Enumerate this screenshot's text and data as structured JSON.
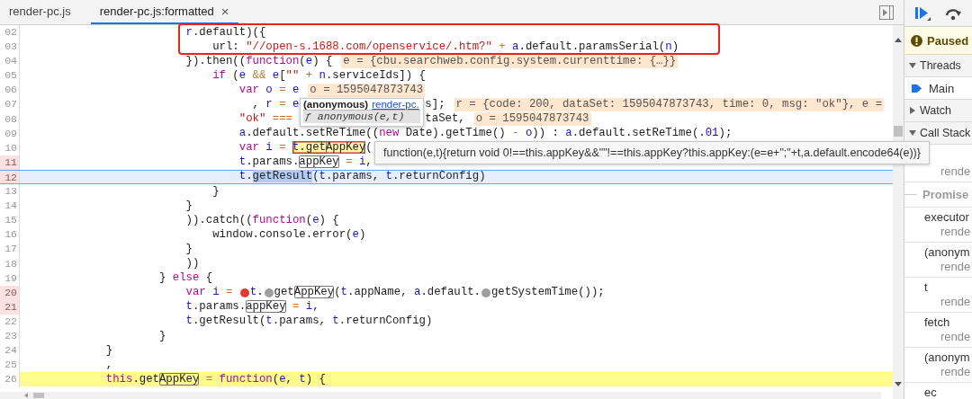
{
  "tabs": [
    {
      "label": "render-pc.js",
      "selected": false
    },
    {
      "label": "render-pc.js:formatted",
      "selected": true,
      "close": "×"
    }
  ],
  "lines": [
    {
      "number": "02",
      "breakpoint": false,
      "selected": false,
      "paused": false,
      "segments": [
        {
          "kind": "name",
          "text": "                        r"
        },
        {
          "kind": "plain",
          "text": ".default)({"
        }
      ]
    },
    {
      "number": "03",
      "breakpoint": false,
      "selected": false,
      "paused": false,
      "segments": [
        {
          "kind": "plain",
          "text": "                            url: "
        },
        {
          "kind": "str",
          "text": "\"//open-s.1688.com/openservice/.htm?\""
        },
        {
          "kind": "op",
          "text": " + "
        },
        {
          "kind": "name",
          "text": "a"
        },
        {
          "kind": "plain",
          "text": ".default.paramsSerial("
        },
        {
          "kind": "name",
          "text": "n"
        },
        {
          "kind": "plain",
          "text": ")"
        }
      ]
    },
    {
      "number": "04",
      "breakpoint": false,
      "selected": false,
      "paused": false,
      "segments": [
        {
          "kind": "plain",
          "text": "                        }).then(("
        },
        {
          "kind": "kw",
          "text": "function"
        },
        {
          "kind": "plain",
          "text": "("
        },
        {
          "kind": "name",
          "text": "e"
        },
        {
          "kind": "plain",
          "text": ") {"
        },
        {
          "kind": "inline",
          "text": "e = {cbu.searchweb.config.system.currenttime: {…}}"
        }
      ]
    },
    {
      "number": "05",
      "breakpoint": false,
      "selected": false,
      "paused": false,
      "segments": [
        {
          "kind": "kw",
          "text": "                            if"
        },
        {
          "kind": "plain",
          "text": " ("
        },
        {
          "kind": "name",
          "text": "e"
        },
        {
          "kind": "op",
          "text": " && "
        },
        {
          "kind": "name",
          "text": "e"
        },
        {
          "kind": "plain",
          "text": "["
        },
        {
          "kind": "str",
          "text": "\"\""
        },
        {
          "kind": "op",
          "text": " + "
        },
        {
          "kind": "name",
          "text": "n"
        },
        {
          "kind": "plain",
          "text": ".serviceIds]) {"
        }
      ]
    },
    {
      "number": "06",
      "breakpoint": false,
      "selected": false,
      "paused": false,
      "segments": [
        {
          "kind": "kw",
          "text": "                                var "
        },
        {
          "kind": "name",
          "text": "o"
        },
        {
          "kind": "op",
          "text": " = "
        },
        {
          "kind": "name",
          "text": "e"
        },
        {
          "kind": "inline",
          "text": "o = 1595047873743"
        }
      ]
    },
    {
      "number": "07",
      "breakpoint": false,
      "selected": false,
      "paused": false,
      "segments": [
        {
          "kind": "plain",
          "text": "                                  , "
        },
        {
          "kind": "name",
          "text": "r"
        },
        {
          "kind": "op",
          "text": " = "
        },
        {
          "kind": "name",
          "text": "e"
        }
      ],
      "after_popup": [
        {
          "kind": "plain",
          "text": "s];"
        },
        {
          "kind": "inline",
          "text": "r = {code: 200, dataSet: 1595047873743, time: 0, msg: \"ok\"}, e ="
        }
      ]
    },
    {
      "number": "08",
      "breakpoint": false,
      "selected": false,
      "paused": false,
      "segments": [
        {
          "kind": "str",
          "text": "                                \"ok\""
        },
        {
          "kind": "op",
          "text": " === "
        }
      ],
      "after_popup": [
        {
          "kind": "plain",
          "text": "taSet,"
        },
        {
          "kind": "inline",
          "text": "o = 1595047873743"
        }
      ]
    },
    {
      "number": "09",
      "breakpoint": false,
      "selected": false,
      "paused": false,
      "segments": [
        {
          "kind": "name",
          "text": "                                a"
        },
        {
          "kind": "plain",
          "text": ".default.setReTime(("
        },
        {
          "kind": "kw",
          "text": "new"
        },
        {
          "kind": "plain",
          "text": " Date).getTime() "
        },
        {
          "kind": "op",
          "text": "-"
        },
        {
          "kind": "name",
          "text": " o"
        },
        {
          "kind": "plain",
          "text": ")) : "
        },
        {
          "kind": "name",
          "text": "a"
        },
        {
          "kind": "plain",
          "text": ".default.setReTime("
        },
        {
          "kind": "num",
          "text": ".01"
        },
        {
          "kind": "plain",
          "text": ");"
        }
      ]
    },
    {
      "number": "10",
      "breakpoint": false,
      "selected": false,
      "paused": false,
      "segments": [
        {
          "kind": "kw",
          "text": "                                var "
        },
        {
          "kind": "name",
          "text": "i"
        },
        {
          "kind": "op",
          "text": " = "
        },
        {
          "kind": "eval",
          "parts": [
            {
              "kind": "name",
              "text": "t"
            },
            {
              "kind": "plain",
              "text": ".get"
            },
            {
              "kind": "search",
              "text": "AppKey"
            }
          ]
        },
        {
          "kind": "plain",
          "text": "("
        }
      ]
    },
    {
      "number": "11",
      "breakpoint": true,
      "selected": false,
      "paused": false,
      "segments": [
        {
          "kind": "name",
          "text": "                                t"
        },
        {
          "kind": "plain",
          "text": ".params."
        },
        {
          "kind": "search",
          "text": "appKey"
        },
        {
          "kind": "op",
          "text": " = "
        },
        {
          "kind": "name",
          "text": "i"
        },
        {
          "kind": "plain",
          "text": ","
        }
      ]
    },
    {
      "number": "12",
      "breakpoint": true,
      "selected": true,
      "paused": false,
      "segments": [
        {
          "kind": "name",
          "text": "                                t"
        },
        {
          "kind": "plain",
          "text": "."
        },
        {
          "kind": "selected",
          "text": "getResult"
        },
        {
          "kind": "plain",
          "text": "("
        },
        {
          "kind": "name",
          "text": "t"
        },
        {
          "kind": "plain",
          "text": ".params, "
        },
        {
          "kind": "name",
          "text": "t"
        },
        {
          "kind": "plain",
          "text": ".returnConfig)"
        }
      ]
    },
    {
      "number": "13",
      "breakpoint": false,
      "selected": false,
      "paused": false,
      "segments": [
        {
          "kind": "plain",
          "text": "                            }"
        }
      ]
    },
    {
      "number": "14",
      "breakpoint": false,
      "selected": false,
      "paused": false,
      "segments": [
        {
          "kind": "plain",
          "text": "                        }"
        }
      ]
    },
    {
      "number": "15",
      "breakpoint": false,
      "selected": false,
      "paused": false,
      "segments": [
        {
          "kind": "plain",
          "text": "                        )).catch(("
        },
        {
          "kind": "kw",
          "text": "function"
        },
        {
          "kind": "plain",
          "text": "("
        },
        {
          "kind": "name",
          "text": "e"
        },
        {
          "kind": "plain",
          "text": ") {"
        }
      ]
    },
    {
      "number": "16",
      "breakpoint": false,
      "selected": false,
      "paused": false,
      "segments": [
        {
          "kind": "plain",
          "text": "                            window.console.error("
        },
        {
          "kind": "name",
          "text": "e"
        },
        {
          "kind": "plain",
          "text": ")"
        }
      ]
    },
    {
      "number": "17",
      "breakpoint": false,
      "selected": false,
      "paused": false,
      "segments": [
        {
          "kind": "plain",
          "text": "                        }"
        }
      ]
    },
    {
      "number": "18",
      "breakpoint": false,
      "selected": false,
      "paused": false,
      "segments": [
        {
          "kind": "plain",
          "text": "                        ))"
        }
      ]
    },
    {
      "number": "19",
      "breakpoint": false,
      "selected": false,
      "paused": false,
      "segments": [
        {
          "kind": "plain",
          "text": "                    } "
        },
        {
          "kind": "kw",
          "text": "else"
        },
        {
          "kind": "plain",
          "text": " {"
        }
      ]
    },
    {
      "number": "20",
      "breakpoint": true,
      "selected": false,
      "paused": false,
      "segments": [
        {
          "kind": "kw",
          "text": "                        var "
        },
        {
          "kind": "name",
          "text": "i"
        },
        {
          "kind": "op",
          "text": " = "
        },
        {
          "kind": "marker",
          "enabled": true
        },
        {
          "kind": "name",
          "text": "t"
        },
        {
          "kind": "plain",
          "text": "."
        },
        {
          "kind": "marker",
          "enabled": false
        },
        {
          "kind": "plain",
          "text": "get"
        },
        {
          "kind": "search",
          "text": "AppKey"
        },
        {
          "kind": "plain",
          "text": "("
        },
        {
          "kind": "name",
          "text": "t"
        },
        {
          "kind": "plain",
          "text": ".appName, "
        },
        {
          "kind": "name",
          "text": "a"
        },
        {
          "kind": "plain",
          "text": ".default."
        },
        {
          "kind": "marker",
          "enabled": false
        },
        {
          "kind": "plain",
          "text": "getSystemTime());"
        }
      ]
    },
    {
      "number": "21",
      "breakpoint": true,
      "selected": false,
      "paused": false,
      "segments": [
        {
          "kind": "name",
          "text": "                        t"
        },
        {
          "kind": "plain",
          "text": ".params."
        },
        {
          "kind": "search",
          "text": "appKey"
        },
        {
          "kind": "op",
          "text": " = "
        },
        {
          "kind": "name",
          "text": "i"
        },
        {
          "kind": "plain",
          "text": ","
        }
      ]
    },
    {
      "number": "22",
      "breakpoint": false,
      "selected": false,
      "paused": false,
      "segments": [
        {
          "kind": "name",
          "text": "                        t"
        },
        {
          "kind": "plain",
          "text": ".getResult("
        },
        {
          "kind": "name",
          "text": "t"
        },
        {
          "kind": "plain",
          "text": ".params, "
        },
        {
          "kind": "name",
          "text": "t"
        },
        {
          "kind": "plain",
          "text": ".returnConfig)"
        }
      ]
    },
    {
      "number": "23",
      "breakpoint": false,
      "selected": false,
      "paused": false,
      "segments": [
        {
          "kind": "plain",
          "text": "                    }"
        }
      ]
    },
    {
      "number": "24",
      "breakpoint": false,
      "selected": false,
      "paused": false,
      "segments": [
        {
          "kind": "plain",
          "text": "            }"
        }
      ]
    },
    {
      "number": "25",
      "breakpoint": false,
      "selected": false,
      "paused": false,
      "segments": [
        {
          "kind": "plain",
          "text": "            ,"
        }
      ]
    },
    {
      "number": "26",
      "breakpoint": false,
      "selected": false,
      "paused": true,
      "segments": [
        {
          "kind": "kw",
          "text": "            this"
        },
        {
          "kind": "plain",
          "text": ".get"
        },
        {
          "kind": "search",
          "text": "AppKey"
        },
        {
          "kind": "op",
          "text": " = "
        },
        {
          "kind": "kw",
          "text": "function"
        },
        {
          "kind": "plain",
          "text": "("
        },
        {
          "kind": "name",
          "text": "e"
        },
        {
          "kind": "plain",
          "text": ", "
        },
        {
          "kind": "name",
          "text": "t"
        },
        {
          "kind": "plain",
          "text": ") {"
        }
      ]
    }
  ],
  "popover": {
    "title": "(anonymous)",
    "link": "render-pc.",
    "items": [
      {
        "text": "ƒ anonymous(e,t)",
        "selected": true
      }
    ]
  },
  "tooltip": {
    "text": "function(e,t){return void 0!==this.appKey&&\"\"!==this.appKey?this.appKey:(e=e+\";\"+t,a.default.encode64(e))}"
  },
  "debugger": {
    "toolbar": [
      {
        "kind": "resume"
      },
      {
        "kind": "step_over"
      }
    ],
    "paused_banner": {
      "text": "Paused"
    },
    "sections": [
      {
        "kind": "threads",
        "title": "Threads",
        "expanded": true,
        "threads": [
          {
            "name": "Main",
            "selected": true
          }
        ]
      },
      {
        "kind": "watch",
        "title": "Watch",
        "expanded": false
      },
      {
        "kind": "call_stack",
        "title": "Call Stack",
        "expanded": true,
        "frames": [
          {
            "kind": "frame",
            "location": "rende"
          },
          {
            "kind": "async",
            "label": "Promise"
          },
          {
            "kind": "frame",
            "name": "executor",
            "location": "rende"
          },
          {
            "kind": "frame",
            "name": "(anonym",
            "location": "rende"
          },
          {
            "kind": "frame",
            "name": "t",
            "location": "rende"
          },
          {
            "kind": "frame",
            "name": "fetch",
            "location": "rende"
          },
          {
            "kind": "frame",
            "name": "(anonym",
            "location": "rende"
          },
          {
            "kind": "frame",
            "name": "ec"
          }
        ]
      }
    ]
  }
}
